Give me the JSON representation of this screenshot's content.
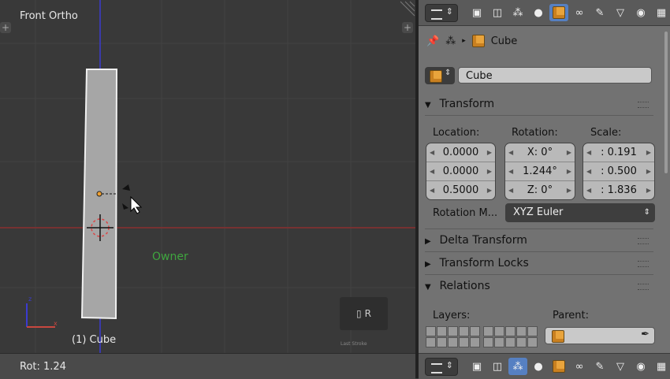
{
  "viewport": {
    "view_label": "Front Ortho",
    "object_label": "(1) Cube",
    "owner_label": "Owner",
    "key_hint": "R",
    "key_hint_small": "Last Stroke"
  },
  "status": {
    "text": "Rot: 1.24"
  },
  "properties": {
    "context": {
      "object": "Cube"
    },
    "object_name": "Cube",
    "transform": {
      "title": "Transform",
      "location_label": "Location:",
      "rotation_label": "Rotation:",
      "scale_label": "Scale:",
      "location": [
        "0.0000",
        "0.0000",
        "0.5000"
      ],
      "rotation": [
        "X:   0°",
        "1.244°",
        "Z:   0°"
      ],
      "scale": [
        ": 0.191",
        ": 0.500",
        ": 1.836"
      ],
      "rotation_mode_label": "Rotation M...",
      "rotation_mode_value": "XYZ Euler"
    },
    "panels": {
      "delta": "Delta Transform",
      "locks": "Transform Locks",
      "relations": "Relations"
    },
    "relations": {
      "layers_label": "Layers:",
      "parent_label": "Parent:"
    }
  },
  "colors": {
    "active_tab": "#5680c2",
    "owner_green": "#3fa53f",
    "x_axis": "#c8473f",
    "y_axis": "#3b3bd0"
  },
  "icons": [
    "render-icon",
    "layers-icon",
    "scene-icon",
    "world-icon",
    "object-icon",
    "constraints-icon",
    "modifiers-icon",
    "data-icon",
    "material-icon",
    "texture-icon"
  ]
}
